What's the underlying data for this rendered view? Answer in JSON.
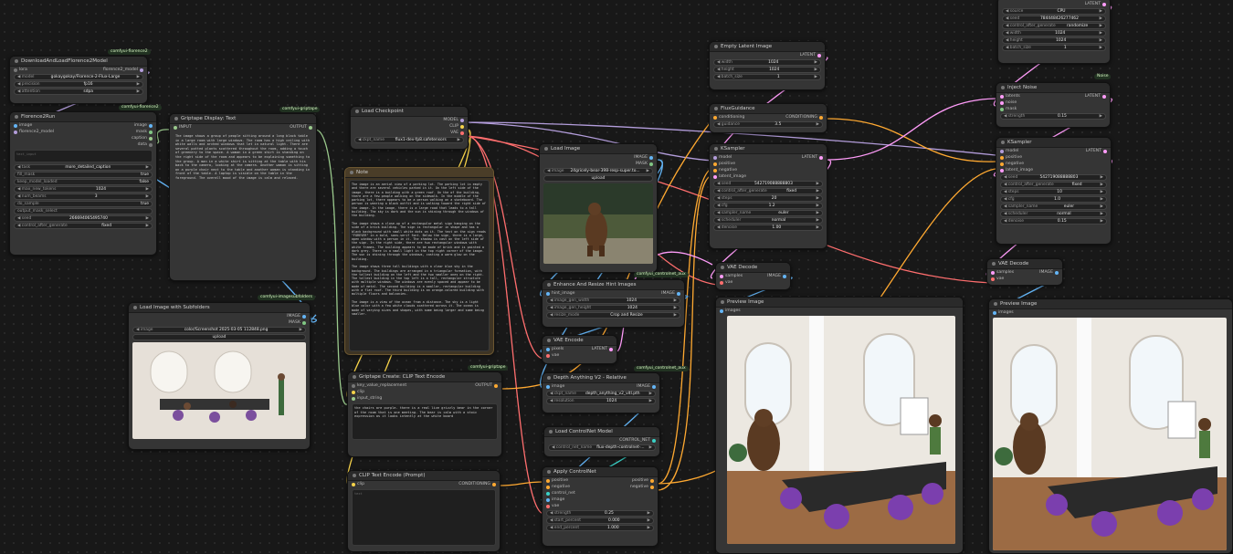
{
  "nodes": {
    "dl_florence": {
      "title": "DownloadAndLoadFlorence2Model",
      "badge": "comfyui-florence2",
      "in": "lora",
      "out": "florence2_model",
      "w": [
        [
          "model",
          "gokaygokay/Florence-2-Flux-Large"
        ],
        [
          "precision",
          "fp16"
        ],
        [
          "attention",
          "sdpa"
        ]
      ]
    },
    "florence_run": {
      "title": "Florence2Run",
      "badge": "comfyui-florence2",
      "in": [
        "image",
        "florence2_model"
      ],
      "out": [
        "image",
        "mask",
        "caption",
        "data"
      ],
      "w": [
        [
          "task",
          "more_detailed_caption"
        ],
        [
          "fill_mask",
          "true"
        ],
        [
          "keep_model_loaded",
          "false"
        ],
        [
          "max_new_tokens",
          "1024"
        ],
        [
          "num_beams",
          "3"
        ],
        [
          "do_sample",
          "true"
        ],
        [
          "output_mask_select",
          ""
        ],
        [
          "seed",
          "266694065495740"
        ],
        [
          "control_after_generate",
          "fixed"
        ]
      ],
      "text_input": "text_input"
    },
    "display_text": {
      "title": "Griptape Display: Text",
      "badge": "comfyui-griptape",
      "in": "INPUT",
      "out": "OUTPUT",
      "text": "The image shows a group of people sitting around a long black table in a large room with large windows. The room has a high ceiling with white walls and arched windows that let in natural light. There are several potted plants scattered throughout the room, adding a touch of greenery to the space. A woman in a green shirt is standing on the right side of the room and appears to be explaining something to the group. A man in a white shirt is sitting at the table with his back to the camera, looking at the camera. Another woman is sitting on a purple chair next to the table and another woman is standing in front of the table. A laptop is visible on the table in the foreground. The overall mood of the image is calm and relaxed."
    },
    "load_ckpt": {
      "title": "Load Checkpoint",
      "out": [
        "MODEL",
        "CLIP",
        "VAE"
      ],
      "w": [
        [
          "ckpt_name",
          "flux1-dev-fp8.safetensors"
        ]
      ]
    },
    "note": {
      "title": "Note",
      "text": "The image is an aerial view of a parking lot. The parking lot is empty and there are several vehicles parked in it. On the left side of the image, there is a building with a green roof. On the of the building, there are a few people walking on the sidewalk. In the middle of the parking lot, there appears to be a person walking on a skateboard. The person is wearing a black outfit and is walking toward the right side of the image. In the image, there is a large road that leads to a tall building. The sky is dark and the sun is shining through the windows of the building.\n\nThe image shows a close-up of a rectangular metal sign hanging on the side of a brick building. The sign is rectangular in shape and has a black background with small white dots on it. The text on the sign reads \"FOREVER\" in a bold, sans-serif font. Below the sign, there is a large, open window with a person in it. The shadow is cast on the left side of the sign. In the right side, there are two rectangular windows with white frames. The building appears to be made of brick and is painted a dark grey. There is a small light in the top right corner of the image. The sun is shining through the windows, casting a warm glow on the building.\n\nThe image shows three tall buildings with a clear blue sky in the background. The buildings are arranged in a triangular formation, with the tallest building on the left and the two smaller ones on the right. The tallest building in the top left is a tall, rectangular structure with multiple windows. The windows are evenly spaced and appear to be made of metal. The second building is a smaller, rectangular building with a flat roof. The third building is an orange-colored building with multiple floors and balconies.\n\nThe image is a view of the ocean from a distance. The sky is a light blue color with a few white clouds scattered across it. The ocean is made of varying sizes and shapes, with some being larger and some being smaller."
    },
    "load_image": {
      "title": "Load Image",
      "badge": "comfyui_controlnet_aux",
      "out": [
        "IMAGE",
        "MASK"
      ],
      "w": [
        [
          "image",
          "24gricely-bear-398-resp-super.to..."
        ]
      ],
      "upload": "upload"
    },
    "load_sub": {
      "title": "Load Image with Subfolders",
      "badge": "comfyui-imagesubfolders",
      "out": [
        "IMAGE",
        "MASK"
      ],
      "w": [
        [
          "image",
          "color/Screenshot 2025-03-05 112848.png"
        ]
      ],
      "upload": "upload"
    },
    "griptape_clip": {
      "title": "Griptape Create: CLIP Text Encode",
      "badge": "comfyui-griptape",
      "in": [
        "key_value_replacement",
        "clip",
        "input_string"
      ],
      "out": "OUTPUT",
      "text": "the chairs are purple. there is a real live grizzly bear in the corner of the room that is one meeting. The bear is calm with a stoic expression as it looks intently at the white board"
    },
    "clip_text": {
      "title": "CLIP Text Encode (Prompt)",
      "in": "clip",
      "out": "CONDITIONING",
      "text": "text"
    },
    "empty_latent": {
      "title": "Empty Latent Image",
      "out": "LATENT",
      "w": [
        [
          "width",
          "1024"
        ],
        [
          "height",
          "1024"
        ],
        [
          "batch_size",
          "1"
        ]
      ]
    },
    "flux_guid": {
      "title": "FluxGuidance",
      "in": "conditioning",
      "out": "CONDITIONING",
      "w": [
        [
          "guidance",
          "3.5"
        ]
      ]
    },
    "ksampler1": {
      "title": "KSampler",
      "in": [
        "model",
        "positive",
        "negative",
        "latent_image"
      ],
      "out": "LATENT",
      "w": [
        [
          "seed",
          "542719088888803"
        ],
        [
          "control_after_generate",
          "fixed"
        ],
        [
          "steps",
          "20"
        ],
        [
          "cfg",
          "1.2"
        ],
        [
          "sampler_name",
          "euler"
        ],
        [
          "scheduler",
          "normal"
        ],
        [
          "denoise",
          "1.00"
        ]
      ]
    },
    "enhance": {
      "title": "Enhance And Resize Hint Images",
      "in": "hint_image",
      "out": "IMAGE",
      "w": [
        [
          "image_gen_width",
          "1024"
        ],
        [
          "image_gen_height",
          "1024"
        ],
        [
          "resize_mode",
          "Crop and Resize"
        ]
      ]
    },
    "vae_enc": {
      "title": "VAE Encode",
      "in": [
        "pixels",
        "vae"
      ],
      "out": "LATENT"
    },
    "depth": {
      "title": "Depth Anything V2 - Relative",
      "badge": "comfyui_controlnet_aux",
      "in": "image",
      "out": "IMAGE",
      "w": [
        [
          "ckpt_name",
          "depth_anything_v2_vitl.pth"
        ],
        [
          "resolution",
          "1024"
        ]
      ]
    },
    "load_cn": {
      "title": "Load ControlNet Model",
      "out": "CONTROL_NET",
      "w": [
        [
          "control_net_name",
          "flux-depth-controlnet-..."
        ]
      ]
    },
    "apply_cn": {
      "title": "Apply ControlNet",
      "in": [
        "positive",
        "negative",
        "control_net",
        "image",
        "vae"
      ],
      "out": [
        "positive",
        "negative"
      ],
      "w": [
        [
          "strength",
          "0.25"
        ],
        [
          "start_percent",
          "0.000"
        ],
        [
          "end_percent",
          "1.000"
        ]
      ]
    },
    "vae_dec1": {
      "title": "VAE Decode",
      "in": [
        "samples",
        "vae"
      ],
      "out": "IMAGE"
    },
    "preview1": {
      "title": "Preview Image",
      "in": "images"
    },
    "noise_gen": {
      "out": "LATENT",
      "w": [
        [
          "source",
          "CPU"
        ],
        [
          "seed",
          "784448426277462"
        ],
        [
          "control_after_generate",
          "randomize"
        ],
        [
          "width",
          "1024"
        ],
        [
          "height",
          "1024"
        ],
        [
          "batch_size",
          "1"
        ]
      ],
      "badge": "Noise"
    },
    "inject_noise": {
      "title": "Inject Noise",
      "in": [
        "latents",
        "noise",
        "mask"
      ],
      "out": "LATENT",
      "w": [
        [
          "strength",
          "0.15"
        ]
      ]
    },
    "ksampler2": {
      "title": "KSampler",
      "in": [
        "model",
        "positive",
        "negative",
        "latent_image"
      ],
      "out": "LATENT",
      "w": [
        [
          "seed",
          "542719088888803"
        ],
        [
          "control_after_generate",
          "fixed"
        ],
        [
          "steps",
          "10"
        ],
        [
          "cfg",
          "1.0"
        ],
        [
          "sampler_name",
          "euler"
        ],
        [
          "scheduler",
          "normal"
        ],
        [
          "denoise",
          "0.15"
        ]
      ]
    },
    "vae_dec2": {
      "title": "VAE Decode",
      "in": [
        "samples",
        "vae"
      ],
      "out": "IMAGE"
    },
    "preview2": {
      "title": "Preview Image",
      "in": "images"
    }
  },
  "colors": {
    "model": "#b39ddb",
    "clip": "#f7d34a",
    "vae": "#ff6e6e",
    "conditioning": "#ffa931",
    "latent": "#ff9cf9",
    "image": "#64b5f6",
    "mask": "#81c784",
    "string": "#9ac98c"
  }
}
